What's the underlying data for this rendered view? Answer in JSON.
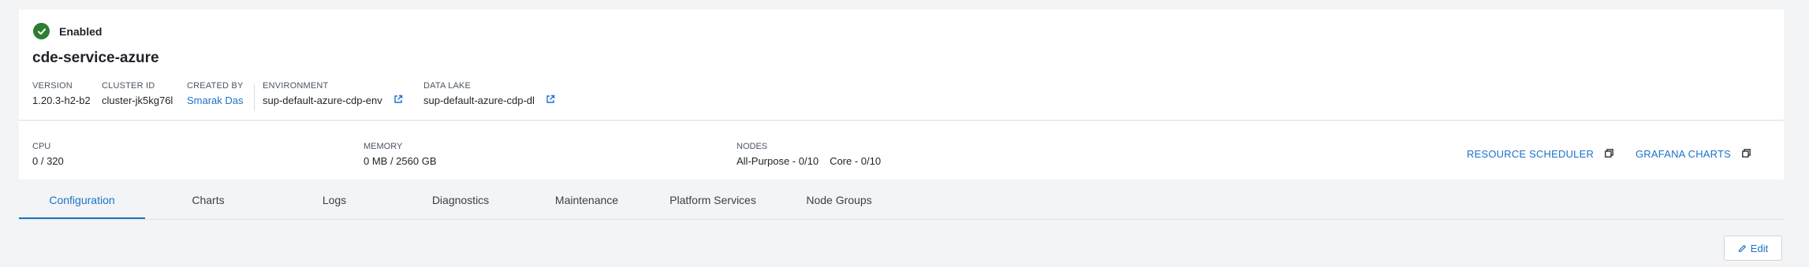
{
  "status": {
    "label": "Enabled",
    "icon": "check-circle-icon",
    "color": "#2e7d32"
  },
  "service": {
    "title": "cde-service-azure"
  },
  "meta": {
    "version": {
      "key": "VERSION",
      "value": "1.20.3-h2-b2"
    },
    "cluster_id": {
      "key": "CLUSTER ID",
      "value": "cluster-jk5kg76l"
    },
    "created_by": {
      "key": "CREATED BY",
      "value": "Smarak Das"
    },
    "environment": {
      "key": "ENVIRONMENT",
      "value": "sup-default-azure-cdp-env",
      "icon": "external-link-icon"
    },
    "data_lake": {
      "key": "DATA LAKE",
      "value": "sup-default-azure-cdp-dl",
      "icon": "external-link-icon"
    }
  },
  "stats": {
    "cpu": {
      "key": "CPU",
      "value": "0 / 320"
    },
    "memory": {
      "key": "MEMORY",
      "value": "0 MB / 2560 GB"
    },
    "nodes": {
      "key": "NODES",
      "all_purpose": "All-Purpose - 0/10",
      "core": "Core - 0/10"
    }
  },
  "actions": {
    "resource_scheduler": {
      "label": "RESOURCE SCHEDULER",
      "icon": "open-in-new-window-icon"
    },
    "grafana_charts": {
      "label": "GRAFANA CHARTS",
      "icon": "open-in-new-window-icon"
    }
  },
  "tabs": [
    {
      "label": "Configuration",
      "active": true
    },
    {
      "label": "Charts"
    },
    {
      "label": "Logs"
    },
    {
      "label": "Diagnostics"
    },
    {
      "label": "Maintenance"
    },
    {
      "label": "Platform Services"
    },
    {
      "label": "Node Groups"
    }
  ],
  "edit": {
    "label": "Edit",
    "icon": "pencil-icon"
  },
  "colors": {
    "accent": "#1a73c9",
    "background": "#f3f4f6",
    "success": "#2e7d32"
  }
}
